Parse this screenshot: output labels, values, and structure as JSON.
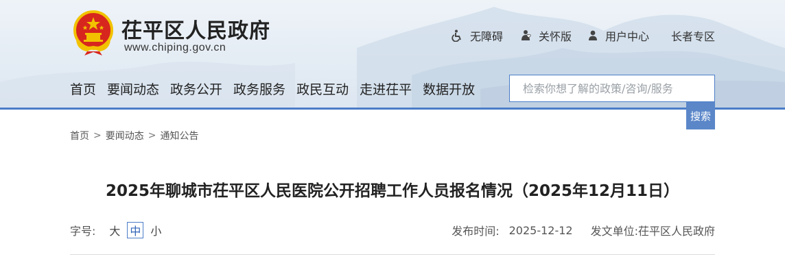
{
  "header": {
    "site_title": "茌平区人民政府",
    "site_url": "www.chiping.gov.cn",
    "top_links": [
      {
        "label": "无障碍",
        "icon": "accessibility-icon"
      },
      {
        "label": "关怀版",
        "icon": "care-icon"
      },
      {
        "label": "用户中心",
        "icon": "user-icon"
      },
      {
        "label": "长者专区"
      }
    ],
    "nav": [
      "首页",
      "要闻动态",
      "政务公开",
      "政务服务",
      "政民互动",
      "走进茌平",
      "数据开放"
    ],
    "search": {
      "placeholder": "检索你想了解的政策/咨询/服务",
      "button": "搜索"
    }
  },
  "breadcrumb": [
    "首页",
    "要闻动态",
    "通知公告"
  ],
  "breadcrumb_sep": ">",
  "article": {
    "title": "2025年聊城市茌平区人民医院公开招聘工作人员报名情况（2025年12月11日）",
    "font_size_label": "字号:",
    "font_sizes": [
      "大",
      "中",
      "小"
    ],
    "selected_font_size": "中",
    "publish_label": "发布时间:",
    "publish_date": "2025-12-12",
    "issuer_label": "发文单位:",
    "issuer": "茌平区人民政府"
  },
  "colors": {
    "accent": "#4a7cc7",
    "button": "#5b87c9",
    "emblem_red": "#d7261e",
    "emblem_gold": "#f2c200"
  }
}
